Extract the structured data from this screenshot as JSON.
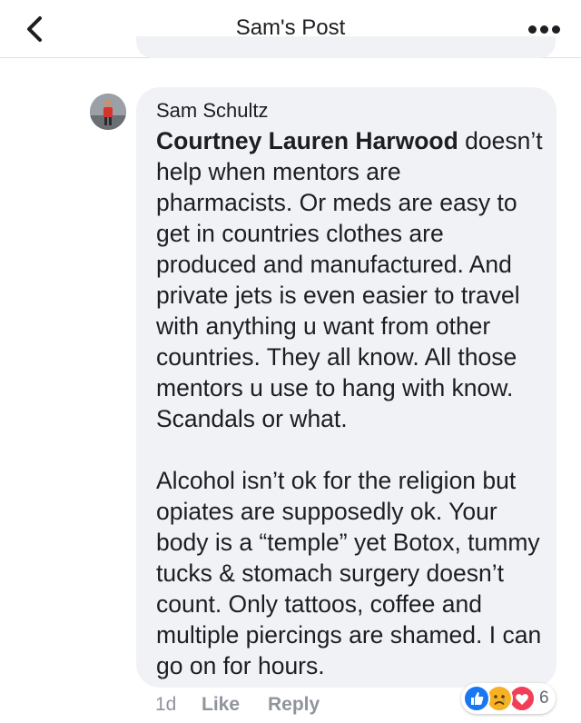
{
  "header": {
    "title": "Sam's Post"
  },
  "comment": {
    "author": "Sam Schultz",
    "mention": "Courtney Lauren Harwood",
    "paragraph_1": "doesn’t help when mentors are pharmacists. Or meds are easy to get in countries clothes are produced and manufactured. And private jets is even easier to travel with anything u want from other countries. They all know. All those mentors u use to hang with know. Scandals or what.",
    "paragraph_2": "Alcohol isn’t ok for the religion but opiates are supposedly ok. Your body is a “temple” yet Botox, tummy tucks & stomach surgery doesn’t count. Only tattoos, coffee and multiple piercings are shamed. I can go on for hours.",
    "time": "1d",
    "like_label": "Like",
    "reply_label": "Reply",
    "reactions": {
      "types": [
        "like",
        "sad",
        "love"
      ],
      "count": "6"
    }
  },
  "colors": {
    "bubble": "#f0f2f5",
    "like": "#1877f2",
    "sad": "#f7b125",
    "love": "#f33e58",
    "meta": "#90949c"
  },
  "icons": {
    "back": "chevron-left-icon",
    "more": "ellipsis-icon",
    "avatar": "user-avatar"
  }
}
